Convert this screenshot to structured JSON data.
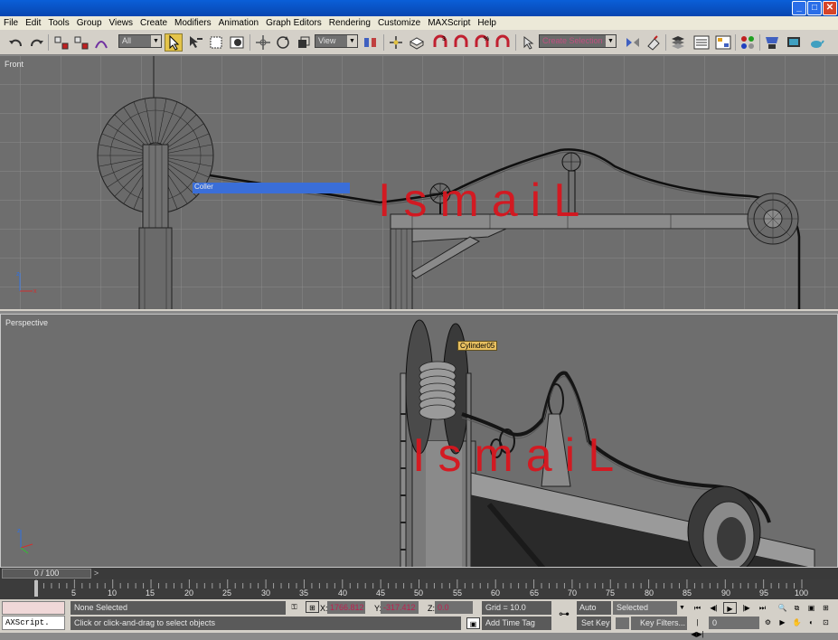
{
  "window": {
    "minimize": "_",
    "maximize": "□",
    "close": "✕"
  },
  "menu": [
    "File",
    "Edit",
    "Tools",
    "Group",
    "Views",
    "Create",
    "Modifiers",
    "Animation",
    "Graph Editors",
    "Rendering",
    "Customize",
    "MAXScript",
    "Help"
  ],
  "toolbar": {
    "selection_filter": "All",
    "ref_coord": "View",
    "named_selection": "Create Selection Se"
  },
  "viewports": {
    "front": {
      "label": "Front",
      "tooltip": "Coller"
    },
    "perspective": {
      "label": "Perspective",
      "tooltip": "Cylinder05"
    },
    "watermark": "IsmaiL"
  },
  "timeline": {
    "slider": "0 / 100",
    "ticks": [
      "5",
      "10",
      "15",
      "20",
      "25",
      "30",
      "35",
      "40",
      "45",
      "50",
      "55",
      "60",
      "65",
      "70",
      "75",
      "80",
      "85",
      "90",
      "95",
      "100"
    ]
  },
  "status": {
    "maxscript": "AXScript.",
    "selection": "None Selected",
    "prompt": "Click or click-and-drag to select objects",
    "x_label": "X:",
    "x_value": "1766.812",
    "y_label": "Y:",
    "y_value": "-317.412",
    "z_label": "Z:",
    "z_value": "0.0",
    "grid": "Grid = 10.0",
    "add_time_tag": "Add Time Tag",
    "auto_key": "Auto Key",
    "set_key": "Set Key",
    "key_mode": "Selected",
    "key_filters": "Key Filters...",
    "frame": "0"
  }
}
